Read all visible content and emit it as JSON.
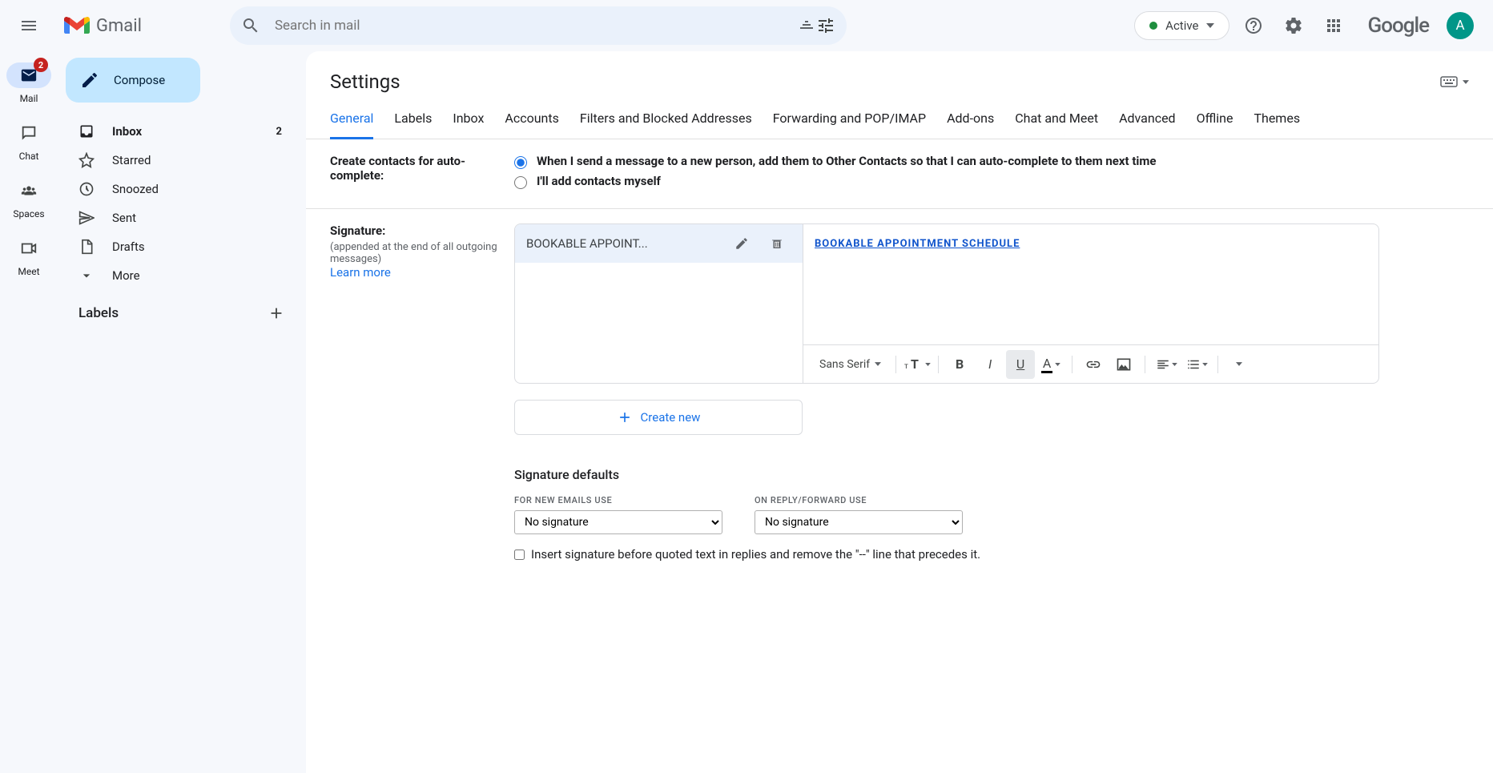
{
  "header": {
    "product": "Gmail",
    "search_placeholder": "Search in mail",
    "status_label": "Active",
    "google_label": "Google",
    "avatar_letter": "A"
  },
  "rail": {
    "mail_label": "Mail",
    "mail_badge": "2",
    "chat_label": "Chat",
    "spaces_label": "Spaces",
    "meet_label": "Meet"
  },
  "sidebar": {
    "compose": "Compose",
    "inbox": "Inbox",
    "inbox_count": "2",
    "starred": "Starred",
    "snoozed": "Snoozed",
    "sent": "Sent",
    "drafts": "Drafts",
    "more": "More",
    "labels_header": "Labels"
  },
  "settings": {
    "title": "Settings",
    "tabs": {
      "general": "General",
      "labels": "Labels",
      "inbox": "Inbox",
      "accounts": "Accounts",
      "filters": "Filters and Blocked Addresses",
      "forwarding": "Forwarding and POP/IMAP",
      "addons": "Add-ons",
      "chatmeet": "Chat and Meet",
      "advanced": "Advanced",
      "offline": "Offline",
      "themes": "Themes"
    },
    "contacts": {
      "label": "Create contacts for auto-complete:",
      "opt1": "When I send a message to a new person, add them to Other Contacts so that I can auto-complete to them next time",
      "opt2": "I'll add contacts myself"
    },
    "signature": {
      "label": "Signature:",
      "sub": "(appended at the end of all outgoing messages)",
      "learn_more": "Learn more",
      "item_name": "BOOKABLE APPOINT...",
      "content_link": "BOOKABLE APPOINTMENT SCHEDULE",
      "font": "Sans Serif",
      "create_new": "Create new",
      "defaults_title": "Signature defaults",
      "new_emails_label": "FOR NEW EMAILS USE",
      "reply_label": "ON REPLY/FORWARD USE",
      "no_sig": "No signature",
      "insert_before": "Insert signature before quoted text in replies and remove the \"--\" line that precedes it."
    }
  }
}
